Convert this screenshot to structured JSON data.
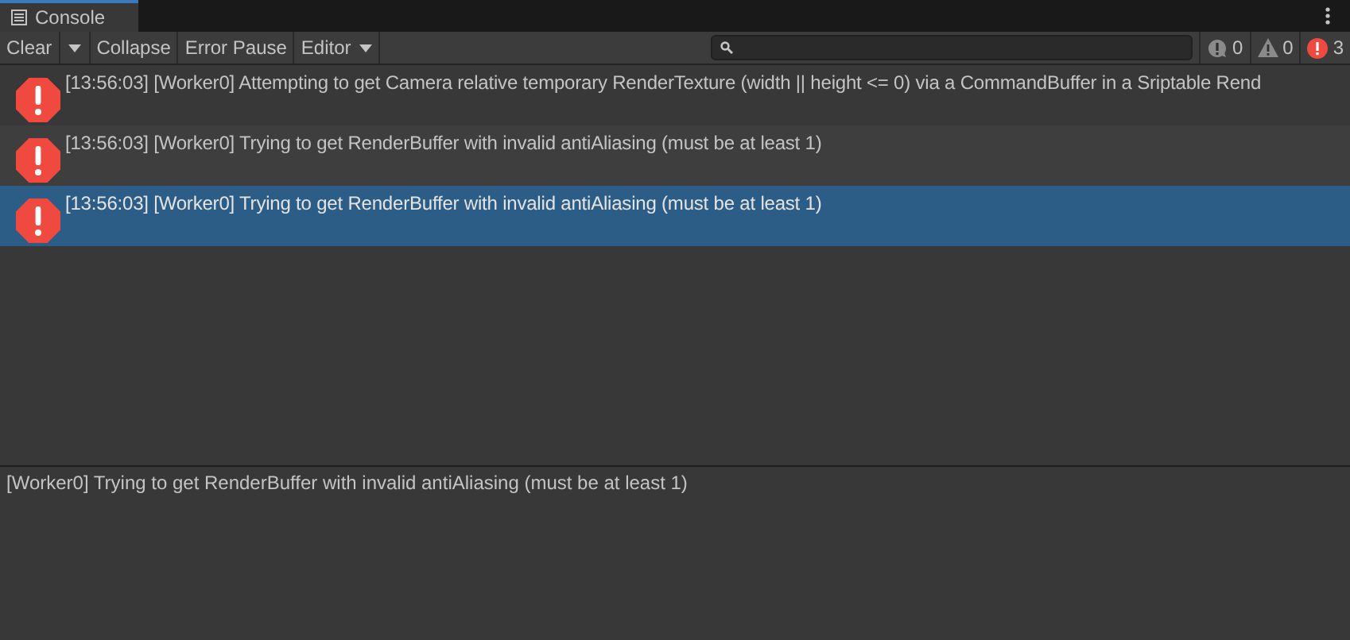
{
  "tab": {
    "title": "Console",
    "selected": true
  },
  "toolbar": {
    "buttons": [
      {
        "kind": "clear",
        "label": "Clear"
      },
      {
        "kind": "dropdown"
      },
      {
        "kind": "toggle",
        "label": "Collapse"
      },
      {
        "kind": "toggle",
        "label": "Error Pause"
      },
      {
        "kind": "menu",
        "label": "Editor"
      }
    ]
  },
  "counters": [
    {
      "kind": "info",
      "count": "0"
    },
    {
      "kind": "warning",
      "count": "0"
    },
    {
      "kind": "error",
      "count": "3"
    }
  ],
  "log": [
    {
      "time": "[13:56:03]",
      "message": "[Worker0] Attempting to get Camera relative temporary RenderTexture (width || height <= 0) via a CommandBuffer  in a Sriptable Rend",
      "selected": false
    },
    {
      "time": "[13:56:03]",
      "message": "[Worker0] Trying to get RenderBuffer with invalid antiAliasing (must be at least 1)",
      "selected": false
    },
    {
      "time": "[13:56:03]",
      "message": "[Worker0] Trying to get RenderBuffer with invalid antiAliasing (must be at least 1)",
      "selected": true
    }
  ],
  "detail": "[Worker0] Trying to get RenderBuffer with invalid antiAliasing (must be at least 1)"
}
